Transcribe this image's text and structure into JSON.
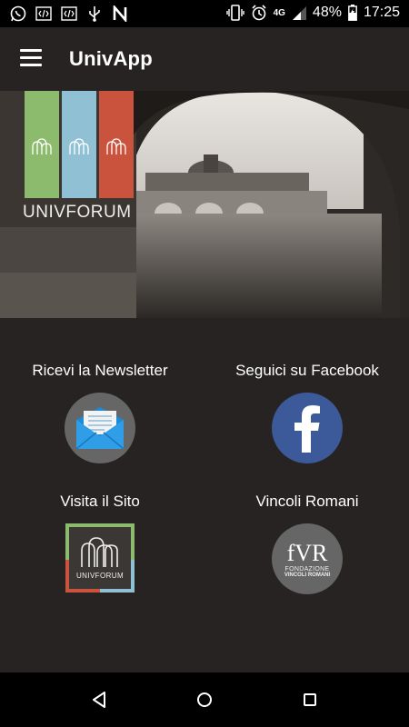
{
  "status": {
    "network": "4G",
    "battery": "48%",
    "time": "17:25"
  },
  "app": {
    "title": "UnivApp",
    "menu_icon": "hamburger-icon"
  },
  "hero": {
    "brand_text": "UNIVFORUM"
  },
  "tiles": [
    {
      "label": "Ricevi la Newsletter",
      "icon": "envelope-icon"
    },
    {
      "label": "Seguici su Facebook",
      "icon": "facebook-icon"
    },
    {
      "label": "Visita il Sito",
      "icon": "univforum-logo"
    },
    {
      "label": "Vincoli Romani",
      "icon": "fvr-logo"
    }
  ],
  "logos": {
    "site_logo_text": "UNIVFORUM",
    "fvr_main": "fVR",
    "fvr_sub1": "FONDAZIONE",
    "fvr_sub2": "VINCOLI ROMANI"
  },
  "colors": {
    "background": "#262322",
    "facebook": "#3c5a9a",
    "stripe_green": "#8dbb6e",
    "stripe_blue": "#8fc0d4",
    "stripe_red": "#c9533d"
  }
}
